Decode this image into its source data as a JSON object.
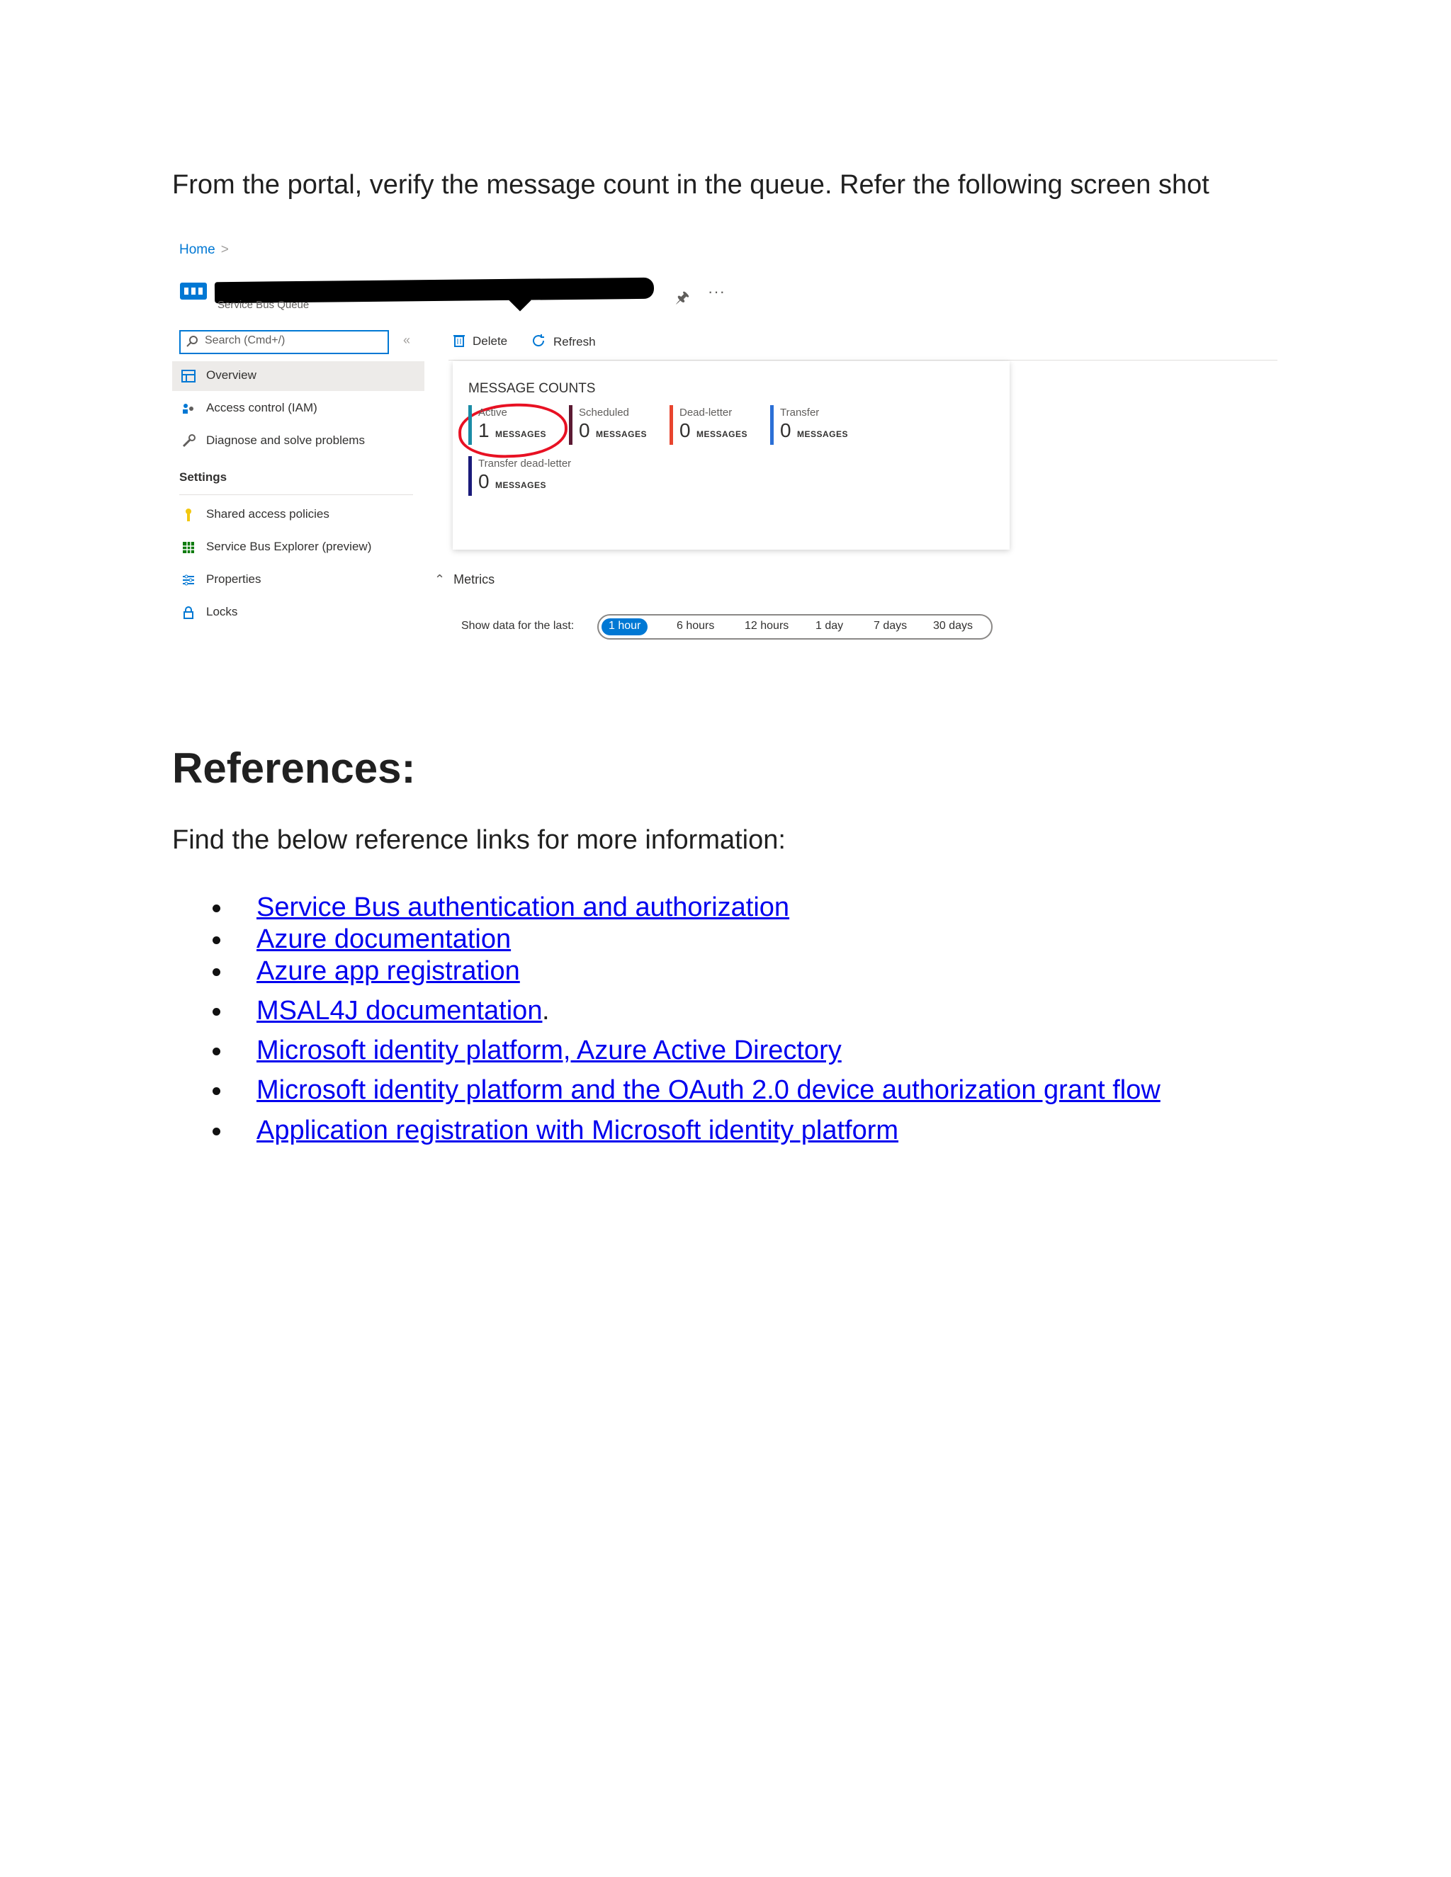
{
  "intro_text": "From the portal, verify the message count in the queue. Refer the following screen shot",
  "screenshot": {
    "breadcrumb": {
      "home": "Home",
      "separator": ">"
    },
    "resource_type": "Service Bus Queue",
    "title_icons": {
      "pin": "pin-icon",
      "more": "···"
    },
    "search": {
      "placeholder": "Search (Cmd+/)",
      "collapse": "«"
    },
    "nav": {
      "overview": "Overview",
      "access_control": "Access control (IAM)",
      "diagnose": "Diagnose and solve problems",
      "settings_header": "Settings",
      "shared_access": "Shared access policies",
      "explorer": "Service Bus Explorer (preview)",
      "properties": "Properties",
      "locks": "Locks"
    },
    "toolbar": {
      "delete": "Delete",
      "refresh": "Refresh"
    },
    "message_counts": {
      "title": "MESSAGE COUNTS",
      "unit": "MESSAGES",
      "items": [
        {
          "label": "Active",
          "value": "1",
          "color": "#1b8ca6"
        },
        {
          "label": "Scheduled",
          "value": "0",
          "color": "#5c1a33"
        },
        {
          "label": "Dead-letter",
          "value": "0",
          "color": "#e8442e"
        },
        {
          "label": "Transfer",
          "value": "0",
          "color": "#2b6fd6"
        },
        {
          "label": "Transfer dead-letter",
          "value": "0",
          "color": "#1a1a7a"
        }
      ],
      "highlight_color": "#e81123"
    },
    "metrics": {
      "label": "Metrics",
      "show_label": "Show data for the last:",
      "ranges": [
        "1 hour",
        "6 hours",
        "12 hours",
        "1 day",
        "7 days",
        "30 days"
      ],
      "selected": "1 hour"
    }
  },
  "references": {
    "heading": "References:",
    "intro": "Find the below reference links for more information:",
    "links": [
      {
        "text": "Service Bus authentication and authorization",
        "tail": ""
      },
      {
        "text": "Azure documentation",
        "tail": ""
      },
      {
        "text": "Azure app registration",
        "tail": ""
      },
      {
        "text": "MSAL4J documentation",
        "tail": "."
      },
      {
        "text": "Microsoft identity platform, Azure Active Directory",
        "tail": ""
      },
      {
        "text": "Microsoft identity platform and the OAuth 2.0 device authorization grant flow",
        "tail": ""
      },
      {
        "text": "Application registration with Microsoft identity platform",
        "tail": ""
      }
    ]
  },
  "colors": {
    "link": "#0000ee",
    "accent": "#0078d4"
  }
}
